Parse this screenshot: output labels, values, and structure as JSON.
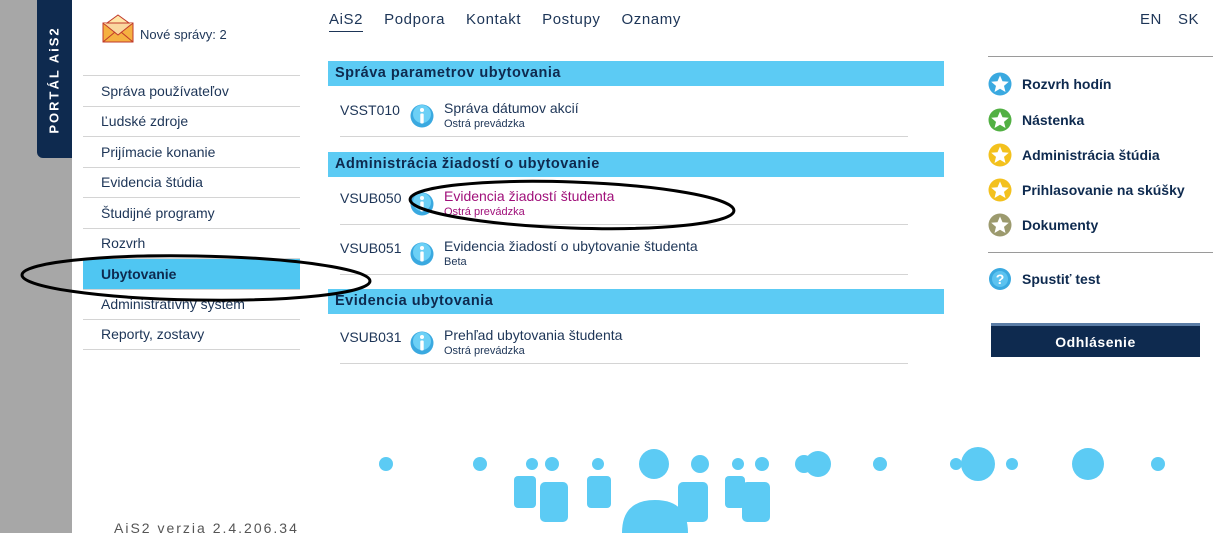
{
  "portal": {
    "label": "PORTÁL AiS2"
  },
  "messages": {
    "label": "Nové správy: 2"
  },
  "top_nav": [
    {
      "label": "AiS2",
      "active": true
    },
    {
      "label": "Podpora"
    },
    {
      "label": "Kontakt"
    },
    {
      "label": "Postupy"
    },
    {
      "label": "Oznamy"
    }
  ],
  "languages": {
    "en": "EN",
    "sk": "SK"
  },
  "left_menu": [
    {
      "label": "Správa používateľov"
    },
    {
      "label": "Ľudské zdroje"
    },
    {
      "label": "Prijímacie konanie"
    },
    {
      "label": "Evidencia štúdia"
    },
    {
      "label": "Študijné programy"
    },
    {
      "label": "Rozvrh"
    },
    {
      "label": "Ubytovanie",
      "active": true
    },
    {
      "label": "Administratívny systém"
    },
    {
      "label": "Reporty, zostavy"
    }
  ],
  "sections": [
    {
      "title": "Správa parametrov ubytovania",
      "rows": [
        {
          "code": "VSST010",
          "title": "Správa dátumov akcií",
          "status": "Ostrá prevádzka",
          "highlighted": false
        }
      ]
    },
    {
      "title": "Administrácia žiadostí o ubytovanie",
      "rows": [
        {
          "code": "VSUB050",
          "title": "Evidencia žiadostí študenta",
          "status": "Ostrá prevádzka",
          "highlighted": true
        },
        {
          "code": "VSUB051",
          "title": "Evidencia žiadostí o ubytovanie študenta",
          "status": "Beta",
          "highlighted": false
        }
      ]
    },
    {
      "title": "Evidencia ubytovania",
      "rows": [
        {
          "code": "VSUB031",
          "title": "Prehľad ubytovania študenta",
          "status": "Ostrá prevádzka",
          "highlighted": false
        }
      ]
    }
  ],
  "right_panel": {
    "items": [
      {
        "label": "Rozvrh hodín",
        "icon": "star-icon",
        "color": "#3aa9e0"
      },
      {
        "label": "Nástenka",
        "icon": "star-icon",
        "color": "#52b043"
      },
      {
        "label": "Administrácia štúdia",
        "icon": "star-icon",
        "color": "#f3c11d"
      },
      {
        "label": "Prihlasovanie na skúšky",
        "icon": "star-icon",
        "color": "#f3c11d"
      },
      {
        "label": "Dokumenty",
        "icon": "star-icon",
        "color": "#9c9a6e"
      }
    ],
    "test": {
      "label": "Spustiť test",
      "icon": "question-icon"
    },
    "logout": {
      "label": "Odhlásenie"
    }
  },
  "version": {
    "label": "AiS2 verzia 2.4.206.34"
  },
  "colors": {
    "accent": "#5ccbf4",
    "dark_navy": "#0e2a4f",
    "highlight_text": "#a0107a"
  }
}
